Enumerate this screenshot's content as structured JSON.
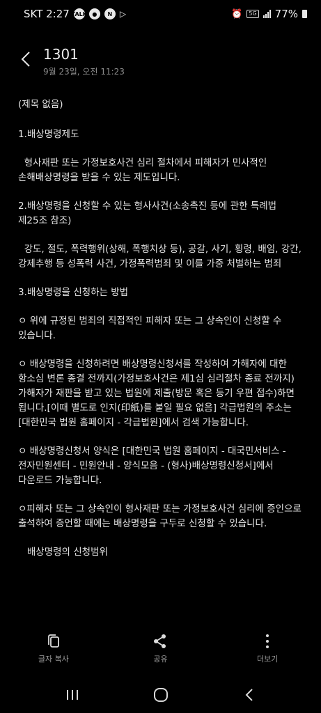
{
  "status_bar": {
    "carrier_time": "SKT 2:27",
    "icons": [
      "talk-icon",
      "messenger-icon",
      "n-icon",
      "play-icon"
    ],
    "network": "5G",
    "battery_text": "77%"
  },
  "header": {
    "title": "1301",
    "date": "9월 23일, 오전 11:23"
  },
  "note": {
    "paragraphs": [
      "(제목 없음)",
      "1.배상명령제도",
      "  형사재판 또는 가정보호사건 심리 절차에서 피해자가 민사적인 손해배상명령을 받을 수 있는 제도입니다.",
      "2.배상명령을 신청할 수 있는 형사사건(소송촉진 등에 관한 특례법 제25조 참조)",
      "  강도, 절도, 폭력행위(상해, 폭행치상 등), 공갈, 사기, 횡령, 배임, 강간, 강제추행 등 성폭력 사건, 가정폭력범죄 및 이를 가중 처벌하는 범죄",
      "3.배상명령을 신청하는 방법",
      "ㅇ 위에 규정된 범죄의 직접적인 피해자 또는 그 상속인이 신청할 수 있습니다.",
      "ㅇ 배상명령을 신청하려면 배상명령신청서를 작성하여 가해자에 대한 항소심 변론 종결 전까지(가정보호사건은 제1심 심리절차 종료 전까지) 가해자가 재판을 받고 있는 법원에 제출(방문 혹은 등기 우편 접수)하면 됩니다.[이때 별도로 인지(印紙)를 붙일 필요 없음] 각급법원의 주소는 [대한민국 법원 홈페이지 - 각급법원]에서 검색 가능합니다.",
      "ㅇ 배상명령신청서 양식은 [대한민국 법원 홈페이지 - 대국민서비스 - 전자민원센터 - 민원안내 - 양식모음 - (형사)배상명령신청서]에서 다운로드 가능합니다.",
      "ㅇ피해자 또는 그 상속인이 형사재판 또는 가정보호사건 심리에 증인으로 출석하여 증언할 때에는 배상명령을 구두로 신청할 수 있습니다.",
      "   배상명령의 신청범위"
    ]
  },
  "actions": {
    "copy_text": "글자 복사",
    "share": "공유",
    "more": "더보기"
  }
}
